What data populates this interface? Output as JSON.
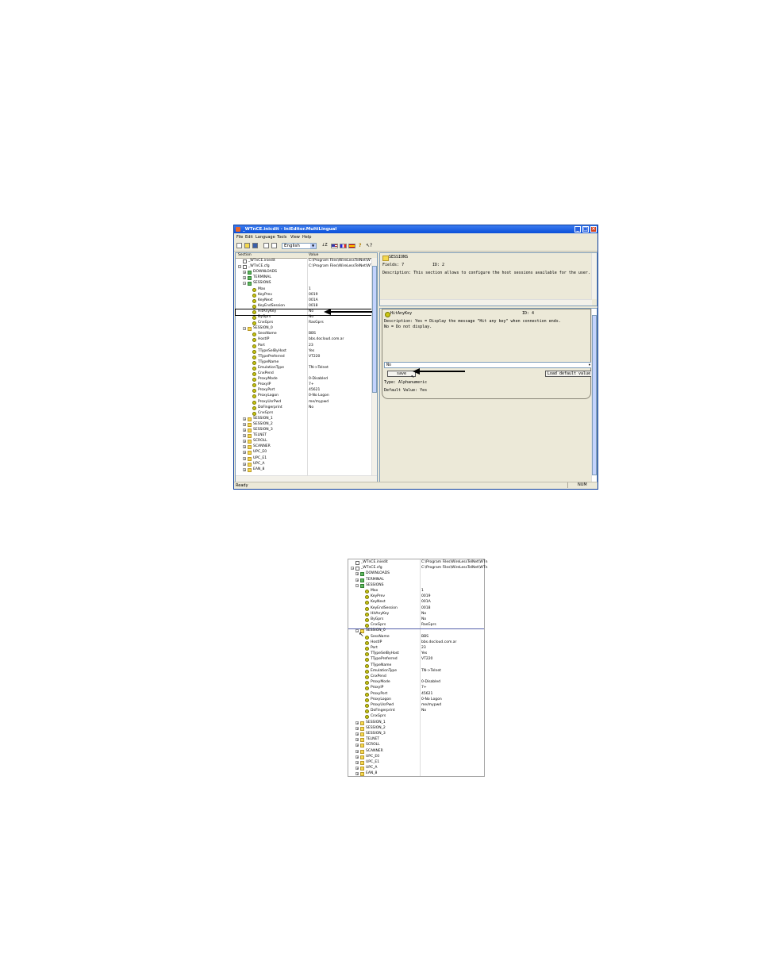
{
  "window": {
    "title": "_WTnCE.inicdit - IniEditor.MultiLingual",
    "menu": [
      "File",
      "Edit",
      "Language",
      "Tools",
      "View",
      "Help"
    ],
    "language_select": "English",
    "status": "Ready",
    "status_num": "NUM"
  },
  "tree": {
    "col_section": "Section",
    "col_value": "Value",
    "rows": [
      {
        "name": "_WTnCE.iniedit",
        "value": "C:\\Program Files\\WireLessTelNet\\WTn"
      },
      {
        "name": "_WTnCE.cfg",
        "value": "C:\\Program Files\\WireLessTelNet\\WTn"
      },
      {
        "name": "DOWNLOADS",
        "value": ""
      },
      {
        "name": "TERMINAL",
        "value": ""
      },
      {
        "name": "SESSIONS",
        "value": ""
      },
      {
        "name": "Max",
        "value": "1"
      },
      {
        "name": "KeyPrev",
        "value": "0019"
      },
      {
        "name": "KeyNext",
        "value": "001A"
      },
      {
        "name": "KeyEndSession",
        "value": "0018"
      },
      {
        "name": "HitAnyKey",
        "value": "No"
      },
      {
        "name": "ByGprs",
        "value": "No"
      },
      {
        "name": "CnxGprs",
        "value": "RasGprs"
      },
      {
        "name": "SESSION_0",
        "value": ""
      },
      {
        "name": "SessName",
        "value": "BBS"
      },
      {
        "name": "HostIP",
        "value": "bbs.docloud.com.ar"
      },
      {
        "name": "Port",
        "value": "23"
      },
      {
        "name": "TTypeSelByHost",
        "value": "Yes"
      },
      {
        "name": "TTypePreferred",
        "value": "VT220"
      },
      {
        "name": "TTypeName",
        "value": ""
      },
      {
        "name": "EmulationType",
        "value": "TN->Telnet"
      },
      {
        "name": "CnxPend",
        "value": ""
      },
      {
        "name": "ProxyMode",
        "value": "0-Disabled"
      },
      {
        "name": "ProxyIP",
        "value": "7+"
      },
      {
        "name": "ProxyPort",
        "value": "45621"
      },
      {
        "name": "ProxyLogon",
        "value": "0-No Logon"
      },
      {
        "name": "ProxyUsrPwd",
        "value": "me/mypwd"
      },
      {
        "name": "DoFingerprint",
        "value": "No"
      },
      {
        "name": "CnxGprs",
        "value": ""
      },
      {
        "name": "SESSION_1",
        "value": ""
      },
      {
        "name": "SESSION_2",
        "value": ""
      },
      {
        "name": "SESSION_3",
        "value": ""
      },
      {
        "name": "TELNET",
        "value": ""
      },
      {
        "name": "SCROLL",
        "value": ""
      },
      {
        "name": "SCANNER",
        "value": ""
      },
      {
        "name": "UPC_E0",
        "value": ""
      },
      {
        "name": "UPC_E1",
        "value": ""
      },
      {
        "name": "UPC_A",
        "value": ""
      },
      {
        "name": "EAN_8",
        "value": ""
      }
    ]
  },
  "info": {
    "section": "SESSIONS",
    "fields": "Fields: 7",
    "id": "ID: 2",
    "description": "Description: This section allows to configure the host sessions available for the user."
  },
  "detail": {
    "key": "HitAnyKey",
    "id": "ID: 4",
    "description1": "Description: Yes = Display the message \"Hit any key\" when connection ends.",
    "description2": "No = Do not display.",
    "value": "No",
    "save": "save",
    "load_default": "Load default value",
    "type": "Type: Alphanumeric",
    "default": "Default Value: Yes"
  }
}
